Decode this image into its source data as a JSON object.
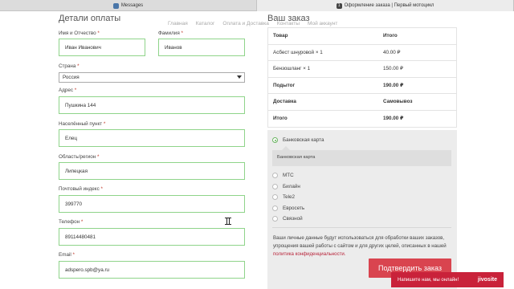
{
  "browser": {
    "tabs": [
      {
        "icon": "vk-icon",
        "title": "Messages"
      },
      {
        "icon": "badge-icon",
        "badge": "1",
        "title": "Оформление заказа | Первый мотоцикл"
      }
    ]
  },
  "nav": [
    "Главная",
    "Каталог",
    "Оплата и Доставка",
    "Контакты",
    "Мой аккаунт"
  ],
  "billing": {
    "title": "Детали оплаты",
    "fields": {
      "first_name": {
        "label": "Имя и Отчество",
        "value": "Иван Иванович"
      },
      "last_name": {
        "label": "Фамилия",
        "value": "Иванов"
      },
      "country": {
        "label": "Страна",
        "value": "Россия"
      },
      "address": {
        "label": "Адрес",
        "value": "Пушкина 144"
      },
      "city": {
        "label": "Населённый пункт",
        "value": "Елец"
      },
      "region": {
        "label": "Область/регион",
        "value": "Липецкая"
      },
      "postcode": {
        "label": "Почтовый индекс",
        "value": "399770"
      },
      "phone": {
        "label": "Телефон",
        "value": "89114480481"
      },
      "email": {
        "label": "Email",
        "value": "adspero.spb@ya.ru"
      }
    },
    "required_mark": "*"
  },
  "order": {
    "title": "Ваш заказ",
    "head": {
      "product": "Товар",
      "total": "Итого"
    },
    "rows": [
      {
        "name": "Асбест шнуровой",
        "qty": "× 1",
        "total": "40.00 ₽"
      },
      {
        "name": "Бензошланг",
        "qty": "× 1",
        "total": "150.00 ₽"
      }
    ],
    "subtotal": {
      "label": "Подытог",
      "value": "190.00 ₽"
    },
    "shipping": {
      "label": "Доставка",
      "value": "Самовывоз"
    },
    "total": {
      "label": "Итого",
      "value": "190.00 ₽"
    }
  },
  "payment": {
    "selected": "Банковская карта",
    "description": "Банковская карта",
    "options": [
      "МТС",
      "Билайн",
      "Tele2",
      "Евросеть",
      "Связной"
    ],
    "privacy_text": "Ваши личные данные будут использоваться для обработки ваших заказов, упрощения вашей работы с сайтом и для других целей, описанных в нашей",
    "privacy_link": "политика конфиденциальности.",
    "confirm_label": "Подтвердить заказ",
    "accent": "#d9444f"
  },
  "chat": {
    "text": "Напишите нам, мы онлайн!",
    "brand": "jivosite",
    "color": "#c9223a"
  }
}
